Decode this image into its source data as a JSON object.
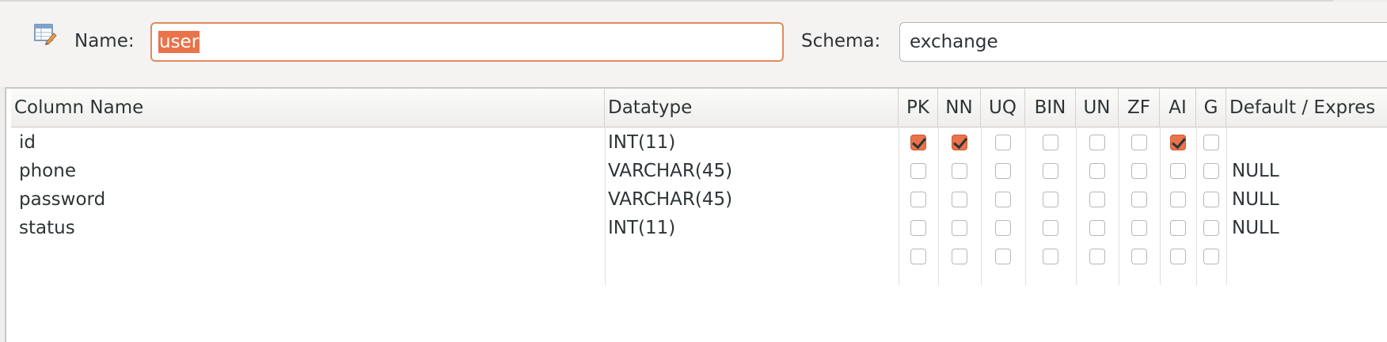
{
  "header": {
    "name_label": "Name:",
    "name_value": "user",
    "schema_label": "Schema:",
    "schema_value": "exchange"
  },
  "columns": {
    "headers": [
      "Column Name",
      "Datatype",
      "PK",
      "NN",
      "UQ",
      "BIN",
      "UN",
      "ZF",
      "AI",
      "G",
      "Default / Expres"
    ]
  },
  "rows": [
    {
      "name": "id",
      "datatype": "INT(11)",
      "flags": {
        "PK": true,
        "NN": true,
        "UQ": false,
        "BIN": false,
        "UN": false,
        "ZF": false,
        "AI": true,
        "G": false
      },
      "default": ""
    },
    {
      "name": "phone",
      "datatype": "VARCHAR(45)",
      "flags": {
        "PK": false,
        "NN": false,
        "UQ": false,
        "BIN": false,
        "UN": false,
        "ZF": false,
        "AI": false,
        "G": false
      },
      "default": "NULL"
    },
    {
      "name": "password",
      "datatype": "VARCHAR(45)",
      "flags": {
        "PK": false,
        "NN": false,
        "UQ": false,
        "BIN": false,
        "UN": false,
        "ZF": false,
        "AI": false,
        "G": false
      },
      "default": "NULL"
    },
    {
      "name": "status",
      "datatype": "INT(11)",
      "flags": {
        "PK": false,
        "NN": false,
        "UQ": false,
        "BIN": false,
        "UN": false,
        "ZF": false,
        "AI": false,
        "G": false
      },
      "default": "NULL"
    },
    {
      "name": "",
      "datatype": "",
      "flags": {
        "PK": false,
        "NN": false,
        "UQ": false,
        "BIN": false,
        "UN": false,
        "ZF": false,
        "AI": false,
        "G": false
      },
      "default": ""
    }
  ],
  "colors": {
    "accent": "#e9734a",
    "background": "#efeeed",
    "border": "#c9c7c4"
  },
  "icons": {
    "table": "table-edit-icon"
  }
}
